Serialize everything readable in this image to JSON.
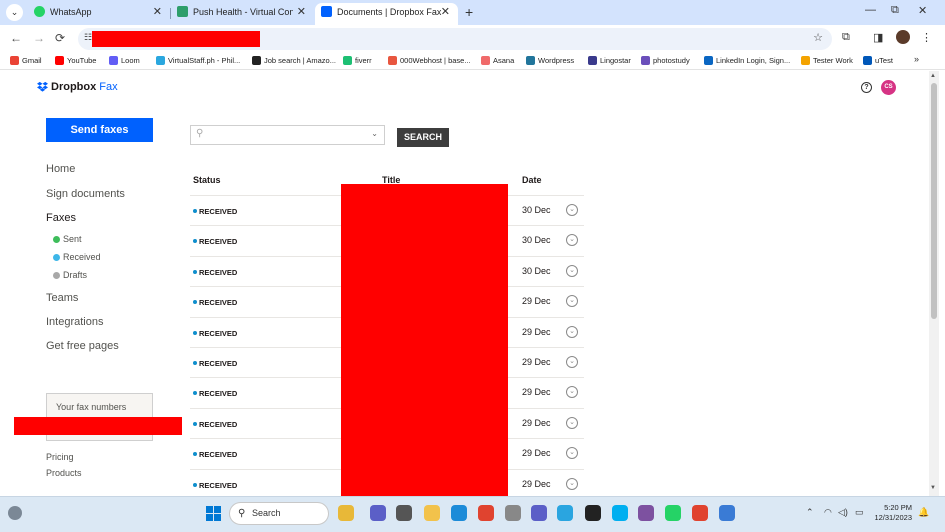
{
  "browser": {
    "tabs": [
      {
        "title": "WhatsApp",
        "favicon_color": "#25d366",
        "active": false
      },
      {
        "title": "Push Health - Virtual Concierge",
        "favicon_color": "#2e9e6b",
        "active": false
      },
      {
        "title": "Documents | Dropbox Fax",
        "favicon_color": "#0061fe",
        "active": true
      }
    ],
    "window_controls": {
      "minimize": "—",
      "maximize": "⧉",
      "close": "✕"
    },
    "new_tab": "+",
    "bookmarks": [
      {
        "label": "Gmail",
        "color": "#ea4335"
      },
      {
        "label": "YouTube",
        "color": "#ff0000"
      },
      {
        "label": "Loom",
        "color": "#625df5"
      },
      {
        "label": "VirtualStaff.ph - Phil...",
        "color": "#2aa7df"
      },
      {
        "label": "Job search | Amazo...",
        "color": "#222222"
      },
      {
        "label": "fiverr",
        "color": "#1dbf73"
      },
      {
        "label": "000Webhost | base...",
        "color": "#e8563f"
      },
      {
        "label": "Asana",
        "color": "#f06a6a"
      },
      {
        "label": "Wordpress",
        "color": "#21759b"
      },
      {
        "label": "Lingostar",
        "color": "#3a3a8c"
      },
      {
        "label": "photostudy",
        "color": "#6b4fbb"
      },
      {
        "label": "LinkedIn Login, Sign...",
        "color": "#0a66c2"
      },
      {
        "label": "Tester Work",
        "color": "#f4a300"
      },
      {
        "label": "uTest",
        "color": "#0057b8"
      }
    ]
  },
  "app": {
    "brand_main": "Dropbox",
    "brand_sub": "Fax",
    "help_glyph": "?",
    "avatar_initials": "CS",
    "send_label": "Send faxes",
    "nav": {
      "home": "Home",
      "sign": "Sign documents",
      "faxes": "Faxes",
      "sent": "Sent",
      "received": "Received",
      "drafts": "Drafts",
      "teams": "Teams",
      "integrations": "Integrations",
      "free_pages": "Get free pages"
    },
    "fax_numbers_label": "Your fax numbers",
    "pricing": "Pricing",
    "products": "Products",
    "search": {
      "placeholder": "",
      "button": "SEARCH"
    },
    "columns": {
      "status": "Status",
      "title": "Title",
      "date": "Date"
    },
    "rows": [
      {
        "status": "RECEIVED",
        "date": "30 Dec"
      },
      {
        "status": "RECEIVED",
        "date": "30 Dec"
      },
      {
        "status": "RECEIVED",
        "date": "30 Dec"
      },
      {
        "status": "RECEIVED",
        "date": "29 Dec"
      },
      {
        "status": "RECEIVED",
        "date": "29 Dec"
      },
      {
        "status": "RECEIVED",
        "date": "29 Dec"
      },
      {
        "status": "RECEIVED",
        "date": "29 Dec"
      },
      {
        "status": "RECEIVED",
        "date": "29 Dec"
      },
      {
        "status": "RECEIVED",
        "date": "29 Dec"
      },
      {
        "status": "RECEIVED",
        "date": "29 Dec"
      }
    ]
  },
  "taskbar": {
    "search_label": "Search",
    "time": "5:20 PM",
    "date": "12/31/2023"
  },
  "colors": {
    "accent": "#0061fe",
    "redaction": "#ff0000",
    "sent_dot": "#3ebd5b",
    "received_dot": "#3db6e8",
    "drafts_dot": "#a8a8a8"
  }
}
